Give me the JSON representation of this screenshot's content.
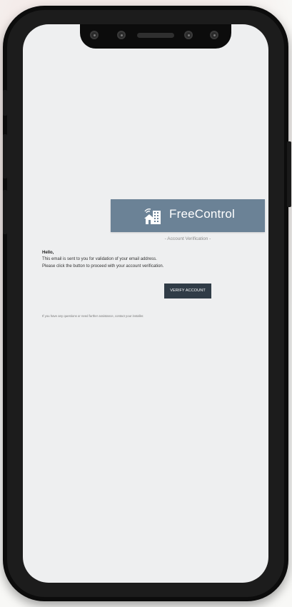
{
  "email": {
    "brand_name": "FreeControl",
    "subtitle": "- Account Verification -",
    "greeting": "Hello,",
    "body_line_1": "This email is sent to you for validation of your email address.",
    "body_line_2": "Please click the button to proceed with your account verification.",
    "verify_button_label": "VERIFY ACCOUNT",
    "footer_note": "If you have any questions or need further assistance, contact your installer."
  },
  "colors": {
    "brand_bar": "#6b8296",
    "button": "#303c47",
    "screen_bg": "#eeeff0",
    "phone_frame": "#0c0c0c"
  },
  "icons": {
    "brand_logo": "smart-building-wifi-icon",
    "notch_cameras": "camera-lens-icon"
  }
}
